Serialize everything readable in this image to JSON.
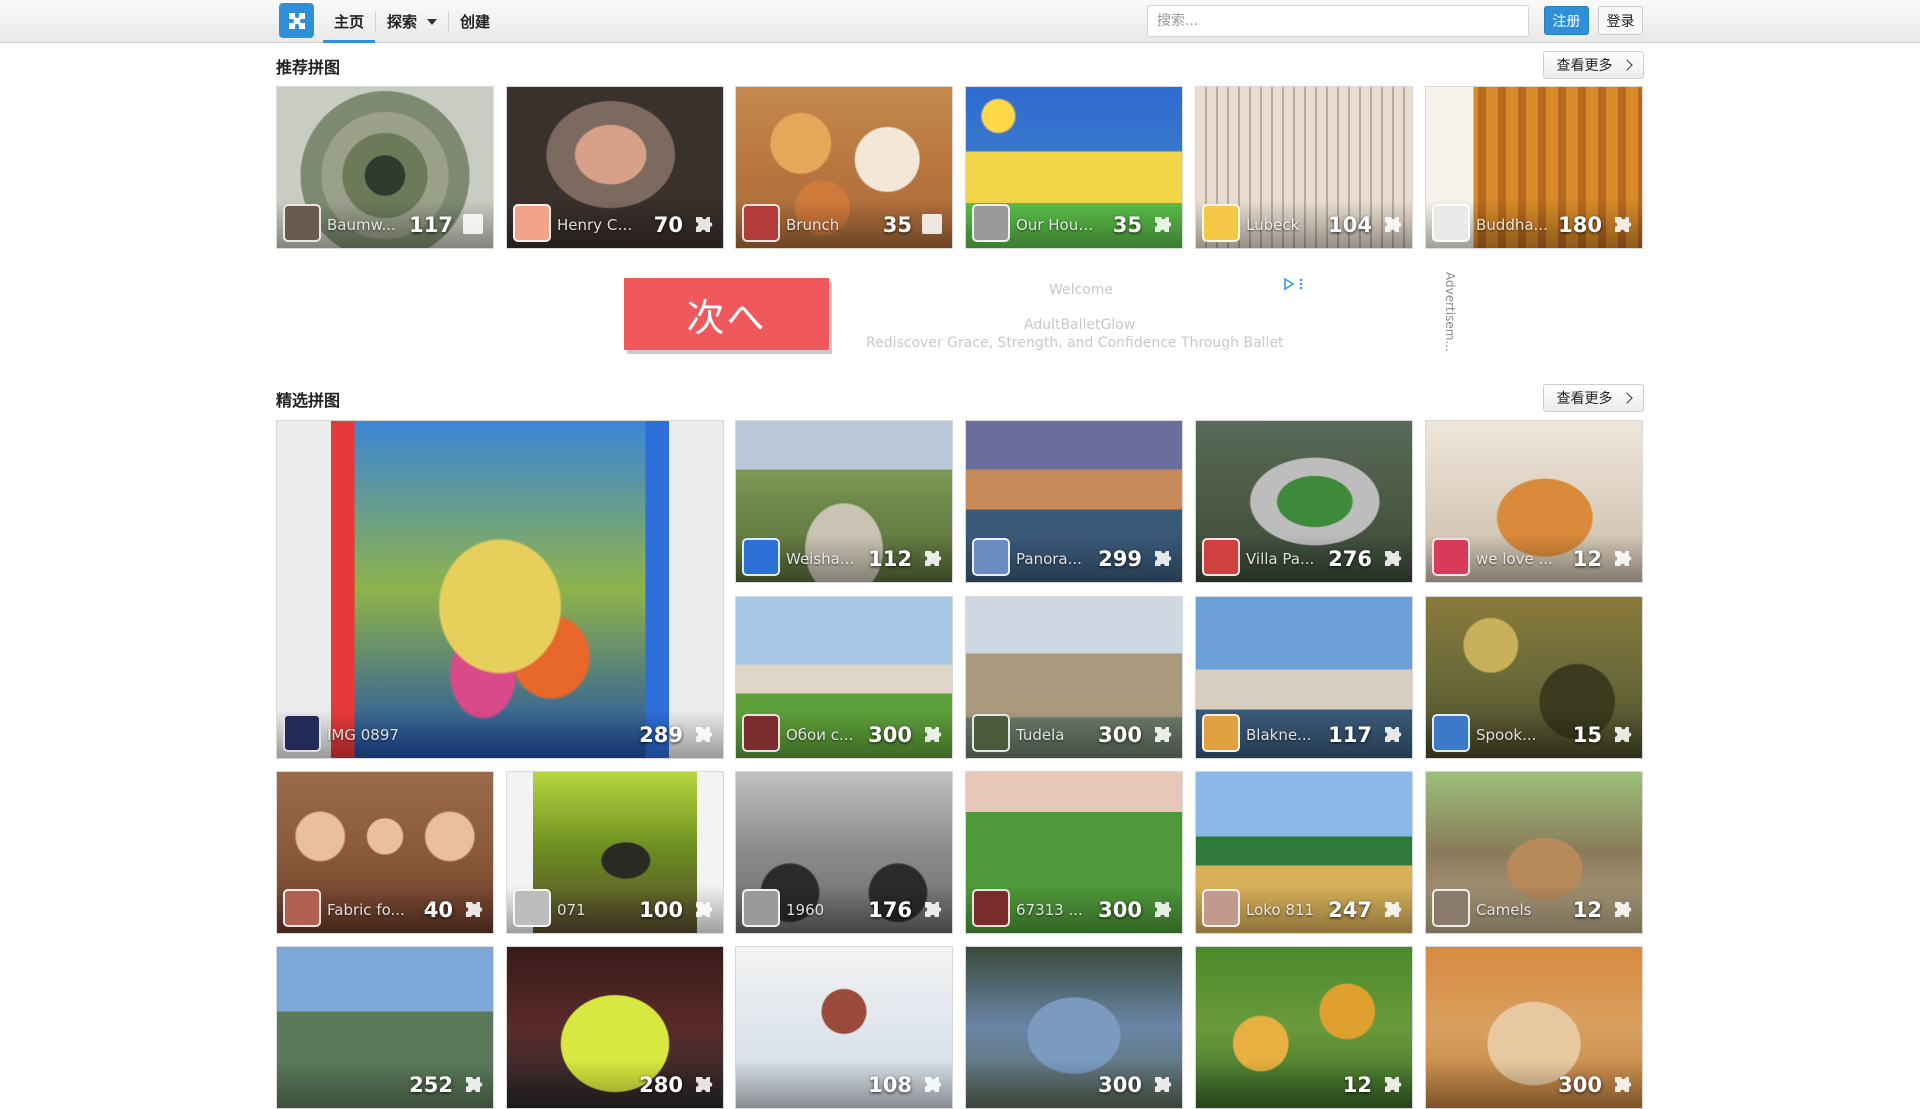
{
  "header": {
    "nav": [
      {
        "label": "主页",
        "active": true
      },
      {
        "label": "探索",
        "dropdown": true
      },
      {
        "label": "创建"
      }
    ],
    "search_placeholder": "搜索...",
    "register": "注册",
    "login": "登录"
  },
  "recommended": {
    "title": "推荐拼图",
    "more": "查看更多",
    "items": [
      {
        "title": "Baumw...",
        "count": "117",
        "kind": "square",
        "bg": "#7e8a70",
        "avatar": "#6a5a52",
        "scene": "ring"
      },
      {
        "title": "Henry Ca...",
        "count": "70",
        "kind": "piece",
        "bg": "#5e5048",
        "avatar": "#f2a38a",
        "scene": "face"
      },
      {
        "title": "Brunch",
        "count": "35",
        "kind": "square",
        "bg": "#c48a4e",
        "avatar": "#b23b3b",
        "scene": "food"
      },
      {
        "title": "Our Hous...",
        "count": "35",
        "kind": "piece",
        "bg": "#3a7cc9",
        "avatar": "#9a9a9a",
        "scene": "house"
      },
      {
        "title": "Lubeck",
        "count": "104",
        "kind": "piece",
        "bg": "#a7b5c6",
        "avatar": "#f4c846",
        "scene": "building"
      },
      {
        "title": "Buddha...",
        "count": "180",
        "kind": "piece",
        "bg": "#b98e5b",
        "avatar": "#eaeaea",
        "scene": "monks"
      }
    ]
  },
  "ad": {
    "button": "次へ",
    "headline": "Welcome",
    "brand": "AdultBalletGlow",
    "tagline": "Rediscover Grace, Strength, and Confidence Through Ballet",
    "side_label": "Advertisem..."
  },
  "featured": {
    "title": "精选拼图",
    "more": "查看更多",
    "big": {
      "title": "IMG 0897",
      "count": "289",
      "kind": "piece",
      "bg": "#3b86d6",
      "avatar": "#222a55",
      "scene": "painting"
    },
    "items": [
      {
        "title": "Weisha...",
        "count": "112",
        "kind": "piece",
        "bg": "#8e9c6a",
        "avatar": "#2e6fd6",
        "scene": "street"
      },
      {
        "title": "Panora...",
        "count": "299",
        "kind": "piece",
        "bg": "#4f5e86",
        "avatar": "#6b8cc0",
        "scene": "city"
      },
      {
        "title": "Villa Pa...",
        "count": "276",
        "kind": "piece",
        "bg": "#4d5a4a",
        "avatar": "#d04040",
        "scene": "stadium"
      },
      {
        "title": "we love ...",
        "count": "12",
        "kind": "piece",
        "bg": "#d8cbb8",
        "avatar": "#d83a5a",
        "scene": "cat"
      },
      {
        "title": "Обои с...",
        "count": "300",
        "kind": "piece",
        "bg": "#6fa64a",
        "avatar": "#7a2b2b",
        "scene": "castle"
      },
      {
        "title": "Tudela",
        "count": "300",
        "kind": "piece",
        "bg": "#a99a7e",
        "avatar": "#4c5a3e",
        "scene": "bridge"
      },
      {
        "title": "Blakne...",
        "count": "117",
        "kind": "piece",
        "bg": "#6a8fb8",
        "avatar": "#e0a040",
        "scene": "harbor"
      },
      {
        "title": "Spook...",
        "count": "15",
        "kind": "piece",
        "bg": "#6a6a3a",
        "avatar": "#3a78c8",
        "scene": "wall"
      },
      {
        "title": "Fabric fo...",
        "count": "40",
        "kind": "piece",
        "bg": "#8a5a3a",
        "avatar": "#b06050",
        "scene": "dolls"
      },
      {
        "title": "071",
        "count": "100",
        "kind": "piece",
        "bg": "#d9d9d9",
        "avatar": "#bdbdbd",
        "scene": "beetle"
      },
      {
        "title": "1960",
        "count": "176",
        "kind": "piece",
        "bg": "#8a8a8a",
        "avatar": "#9a9a9a",
        "scene": "moto"
      },
      {
        "title": "67313 ...",
        "count": "300",
        "kind": "piece",
        "bg": "#4e8a3a",
        "avatar": "#7a2b2b",
        "scene": "moss"
      },
      {
        "title": "Loko 811",
        "count": "247",
        "kind": "piece",
        "bg": "#c7a04a",
        "avatar": "#c09a8a",
        "scene": "train"
      },
      {
        "title": "Camels",
        "count": "12",
        "kind": "piece",
        "bg": "#8a7a5a",
        "avatar": "#8a7a6a",
        "scene": "camels"
      }
    ],
    "partial": [
      {
        "count": "252",
        "bg": "#6b8fc0",
        "scene": "mount"
      },
      {
        "count": "280",
        "bg": "#c9d23a",
        "scene": "car"
      },
      {
        "count": "108",
        "bg": "#e8e8e8",
        "scene": "snow"
      },
      {
        "count": "300",
        "bg": "#6a86a8",
        "scene": "van"
      },
      {
        "count": "12",
        "bg": "#6a9a3a",
        "scene": "apples"
      },
      {
        "count": "300",
        "bg": "#d8a060",
        "scene": "kitten"
      }
    ]
  }
}
